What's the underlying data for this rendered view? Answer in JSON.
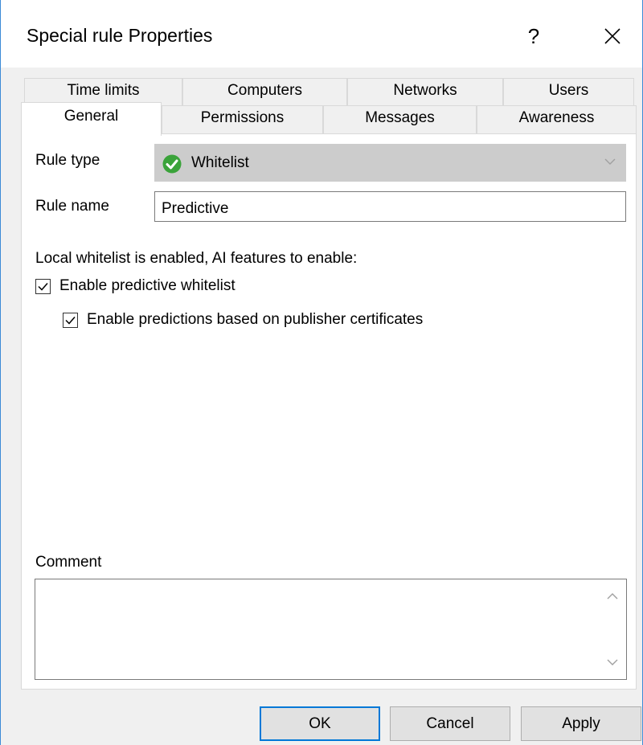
{
  "window": {
    "title": "Special rule Properties",
    "help_label": "?",
    "close_icon": "close-icon"
  },
  "tabs": {
    "row1": [
      "Time limits",
      "Computers",
      "Networks",
      "Users"
    ],
    "row2": [
      "General",
      "Permissions",
      "Messages",
      "Awareness"
    ],
    "active": "General"
  },
  "general": {
    "rule_type_label": "Rule type",
    "rule_type_value": "Whitelist",
    "rule_type_icon": "green-checkmark-icon",
    "rule_name_label": "Rule name",
    "rule_name_value": "Predictive",
    "info_text": "Local whitelist is enabled, AI features to enable:",
    "checkbox_predictive": {
      "label": "Enable predictive whitelist",
      "checked": true
    },
    "checkbox_certificates": {
      "label": "Enable predictions based on publisher certificates",
      "checked": true
    },
    "comment_label": "Comment",
    "comment_value": ""
  },
  "buttons": {
    "ok": "OK",
    "cancel": "Cancel",
    "apply": "Apply"
  },
  "colors": {
    "accent": "#0078d7",
    "window_border": "#3c8ad6",
    "check_green": "#3aa33a",
    "combo_disabled_bg": "#cccccc"
  }
}
